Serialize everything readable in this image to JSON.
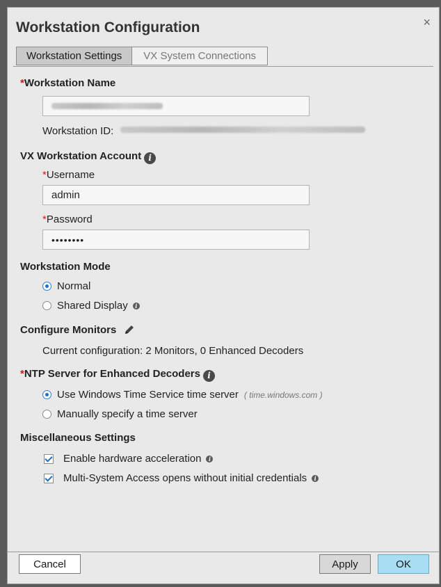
{
  "dialog": {
    "title": "Workstation Configuration",
    "close_glyph": "×"
  },
  "tabs": [
    {
      "label": "Workstation Settings",
      "active": true
    },
    {
      "label": "VX System Connections",
      "active": false
    }
  ],
  "workstation_name": {
    "required_mark": "*",
    "label": "Workstation Name",
    "id_label": "Workstation ID:"
  },
  "account": {
    "label": "VX Workstation Account",
    "username_label": "Username",
    "username_value": "admin",
    "password_label": "Password",
    "password_value": "••••••••"
  },
  "mode": {
    "label": "Workstation Mode",
    "options": [
      {
        "label": "Normal",
        "selected": true
      },
      {
        "label": "Shared Display",
        "selected": false
      }
    ]
  },
  "monitors": {
    "label": "Configure Monitors",
    "current": "Current configuration: 2 Monitors, 0 Enhanced Decoders"
  },
  "ntp": {
    "required_mark": "*",
    "label": "NTP Server for Enhanced Decoders",
    "options": [
      {
        "label": "Use Windows Time Service time server",
        "hint": "( time.windows.com )",
        "selected": true
      },
      {
        "label": "Manually specify a time server",
        "selected": false
      }
    ]
  },
  "misc": {
    "label": "Miscellaneous Settings",
    "options": [
      {
        "label": "Enable hardware acceleration",
        "checked": true
      },
      {
        "label": "Multi-System Access opens without initial credentials",
        "checked": true
      }
    ]
  },
  "buttons": {
    "cancel": "Cancel",
    "apply": "Apply",
    "ok": "OK"
  },
  "icons": {
    "info": "i",
    "pencil": "pencil-icon"
  },
  "colors": {
    "required": "#d11a1a",
    "accent": "#1f6fc4",
    "ok_button": "#a8ddf2"
  }
}
